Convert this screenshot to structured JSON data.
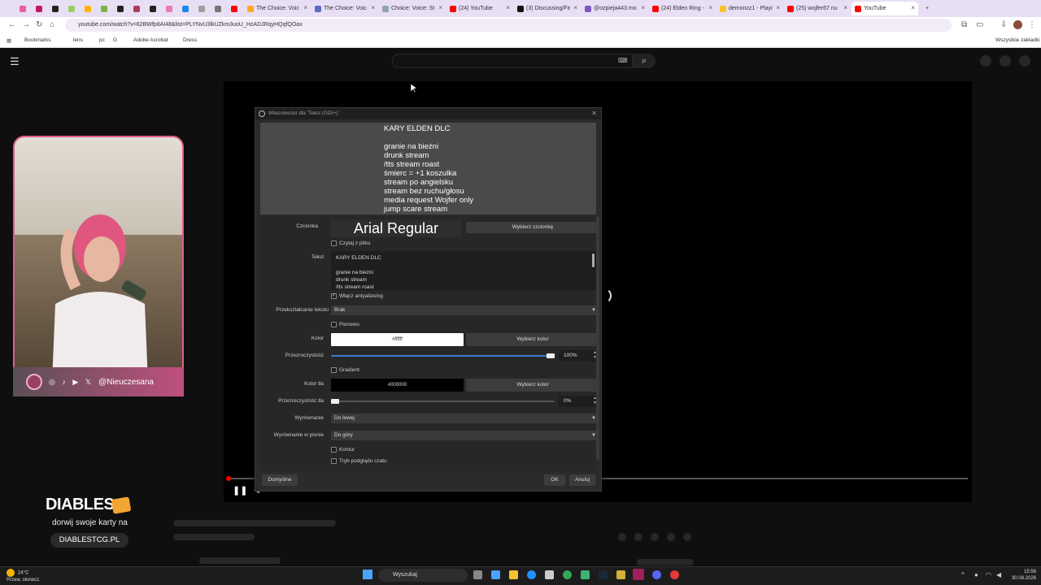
{
  "browser": {
    "tabs": [
      {
        "label": "",
        "color": "#e85d9b"
      },
      {
        "label": "",
        "color": "#c2185b"
      },
      {
        "label": "",
        "color": "#222222"
      },
      {
        "label": "",
        "color": "#9ccc65"
      },
      {
        "label": "",
        "color": "#ffb300"
      },
      {
        "label": "",
        "color": "#7cb342"
      },
      {
        "label": "",
        "color": "#222222"
      },
      {
        "label": "",
        "color": "#a73e5c"
      },
      {
        "label": "",
        "color": "#222222"
      },
      {
        "label": "",
        "color": "#e57ab0"
      },
      {
        "label": "",
        "color": "#1e88e5"
      },
      {
        "label": "",
        "color": "#9e9e9e"
      },
      {
        "label": "",
        "color": "#757575"
      },
      {
        "label": "",
        "color": "#ff0000"
      },
      {
        "label": "The Choice: Voic",
        "color": "#f9a825"
      },
      {
        "label": "The Choice: Voic",
        "color": "#5c6bc0"
      },
      {
        "label": "Choice: Voice: St",
        "color": "#90a4ae"
      },
      {
        "label": "(24) YouTube",
        "color": "#ff0000"
      },
      {
        "label": "(3) Discussing/Fir",
        "color": "#111111"
      },
      {
        "label": "@ozpieja443 mo",
        "color": "#7e57c2"
      },
      {
        "label": "(24) Elden Ring -",
        "color": "#ff0000"
      },
      {
        "label": "demonzz1 - Playi",
        "color": "#fbc02d"
      },
      {
        "label": "(25) wojfer67 nu",
        "color": "#ff0000"
      },
      {
        "label": "YouTube",
        "color": "#ff0000"
      }
    ],
    "url": "youtube.com/watch?v=62BWfp8AI48&list=PLYNvU3lkUZkm3uoU_HzADJRqyHQqfQOax",
    "bookmarks": [
      "Bookmarks",
      "lens",
      "pc",
      "G",
      "Adobe Acrobat",
      "Dress"
    ],
    "all_bookmarks": "Wszystkie zakładki"
  },
  "overlay": {
    "handle": "@Nieuczesana",
    "social_icons": "◎ ♪ ▶ 𝕏",
    "sponsor_name": "DIABLES",
    "sponsor_tag": "dorwij swoje karty na",
    "sponsor_url": "DIABLESTCG.PL"
  },
  "dialog": {
    "title": "Właściwości dla 'Tekst (GDI+)'",
    "close": "✕",
    "preview_text": "KARY ELDEN DLC\n\ngranie na bieżni\ndrunk stream\n/tts stream roast\nśmierc = +1 koszulka\nstream po angielsku\nstream bez ruchu/głosu\nmedia request Wojfer only\njump scare stream",
    "font_label": "Czcionka",
    "font_name": "Arial Regular",
    "choose_font": "Wybierz czcionkę",
    "read_from_file": "Czytaj z pliku",
    "text_label": "Tekst",
    "text_value": "KARY ELDEN DLC\n\ngranie na bieżni\ndrunk stream\n/tts stream roast",
    "antialiasing": "Włącz antyaliasing",
    "transform_label": "Przekształcanie tekstu",
    "transform_value": "Brak",
    "vertical": "Pionowo",
    "color_label": "Kolor",
    "color_value": "#ffffff",
    "choose_color": "Wybierz kolor",
    "opacity_label": "Przezroczystość",
    "opacity_value": "100%",
    "opacity_fraction": 1.0,
    "gradient": "Gradient",
    "bg_color_label": "Kolor tła",
    "bg_color_value": "#000000",
    "choose_bg_color": "Wybierz kolor",
    "bg_opacity_label": "Przezroczystość tła",
    "bg_opacity_value": "0%",
    "bg_opacity_fraction": 0.0,
    "align_label": "Wyrównanie",
    "align_value": "Do lewej",
    "valign_label": "Wyrównanie w pionie",
    "valign_value": "Do góry",
    "outline": "Kontur",
    "chat_mode": "Tryb podglądu czatu",
    "defaults_button": "Domyślne",
    "ok_button": "OK",
    "cancel_button": "Anuluj"
  },
  "taskbar": {
    "weather_temp": "24°C",
    "weather_desc": "Przew. słonecz.",
    "search": "Wyszukaj",
    "time": "15:56",
    "date": "30.08.2026"
  }
}
